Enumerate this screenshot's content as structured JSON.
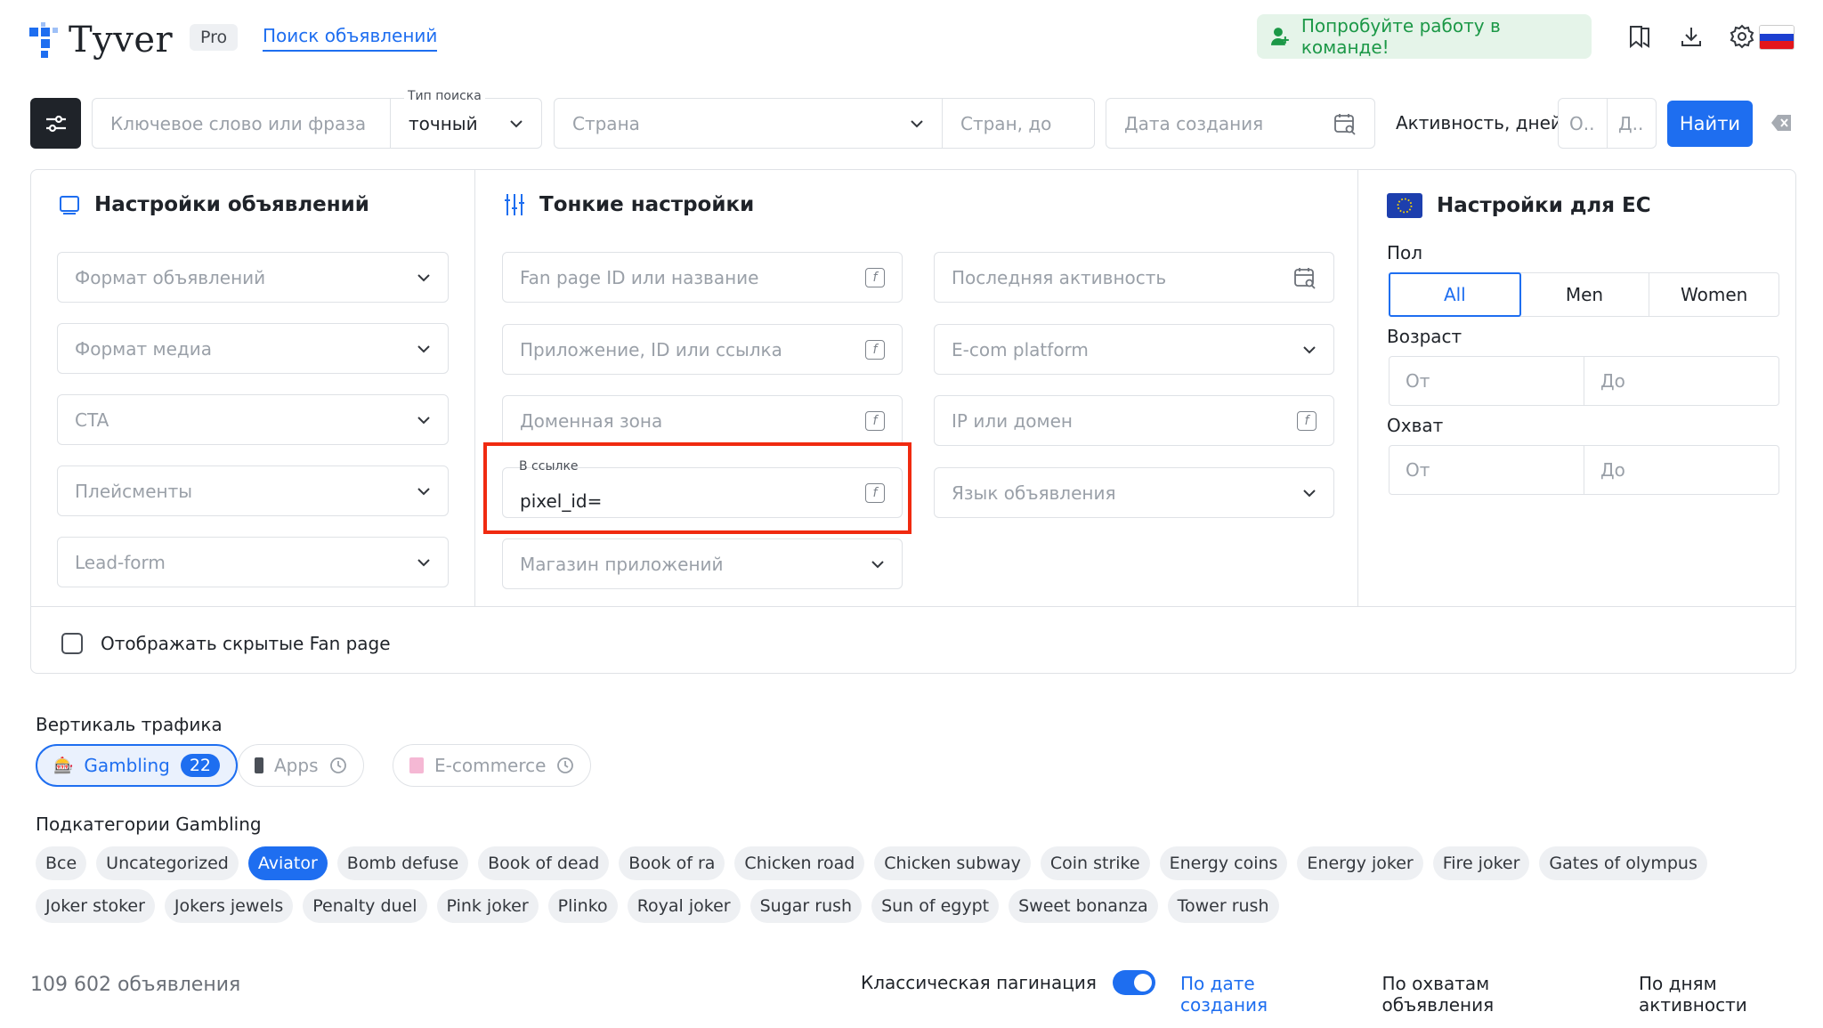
{
  "header": {
    "logo_text": "Tyver",
    "badge": "Pro",
    "nav_link": "Поиск объявлений",
    "team_cta": "Попробуйте работу в команде!"
  },
  "search": {
    "keyword_placeholder": "Ключевое слово или фраза",
    "search_type_label": "Тип поиска",
    "search_type_value": "точный",
    "country_placeholder": "Страна",
    "country_to_placeholder": "Стран, до",
    "created_date_placeholder": "Дата создания",
    "activity_label": "Активность, дней",
    "activity_from_placeholder": "О..",
    "activity_to_placeholder": "Д..",
    "find_button": "Найти"
  },
  "ad_settings": {
    "title": "Настройки объявлений",
    "fields": [
      "Формат объявлений",
      "Формат медиа",
      "CTA",
      "Плейсменты",
      "Lead-form"
    ]
  },
  "fine_settings": {
    "title": "Тонкие настройки",
    "fanpage_placeholder": "Fan page ID или название",
    "app_placeholder": "Приложение, ID или ссылка",
    "domain_zone_placeholder": "Доменная зона",
    "in_link_label": "В ссылке",
    "in_link_value": "pixel_id=",
    "app_store_placeholder": "Магазин приложений",
    "last_activity_placeholder": "Последняя активность",
    "ecom_placeholder": "E-com platform",
    "ip_domain_placeholder": "IP или домен",
    "ad_language_placeholder": "Язык объявления"
  },
  "eu_settings": {
    "title": "Настройки для ЕС",
    "gender_label": "Пол",
    "gender_options": [
      "All",
      "Men",
      "Women"
    ],
    "gender_selected": "All",
    "age_label": "Возраст",
    "reach_label": "Охват",
    "from_placeholder": "От",
    "to_placeholder": "До"
  },
  "hidden_fanpage_label": "Отображать скрытые Fan page",
  "verticals": {
    "label": "Вертикаль трафика",
    "items": [
      {
        "name": "Gambling",
        "count": "22",
        "active": true
      },
      {
        "name": "Apps",
        "active": false
      },
      {
        "name": "E-commerce",
        "active": false
      }
    ]
  },
  "subcategories": {
    "label": "Подкатегории Gambling",
    "selected": "Aviator",
    "items": [
      "Все",
      "Uncategorized",
      "Aviator",
      "Bomb defuse",
      "Book of dead",
      "Book of ra",
      "Chicken road",
      "Chicken subway",
      "Coin strike",
      "Energy coins",
      "Energy joker",
      "Fire joker",
      "Gates of olympus",
      "Joker stoker",
      "Jokers jewels",
      "Penalty duel",
      "Pink joker",
      "Plinko",
      "Royal joker",
      "Sugar rush",
      "Sun of egypt",
      "Sweet bonanza",
      "Tower rush"
    ]
  },
  "results": {
    "count_text": "109 602 объявления",
    "pagination_label": "Классическая пагинация",
    "sort_options": [
      "По дате создания",
      "По охватам объявления",
      "По дням активности"
    ],
    "sort_selected": "По дате создания"
  },
  "colors": {
    "accent": "#1e6ef0",
    "highlight_box": "#f02a10",
    "team_green": "#1c9847"
  }
}
